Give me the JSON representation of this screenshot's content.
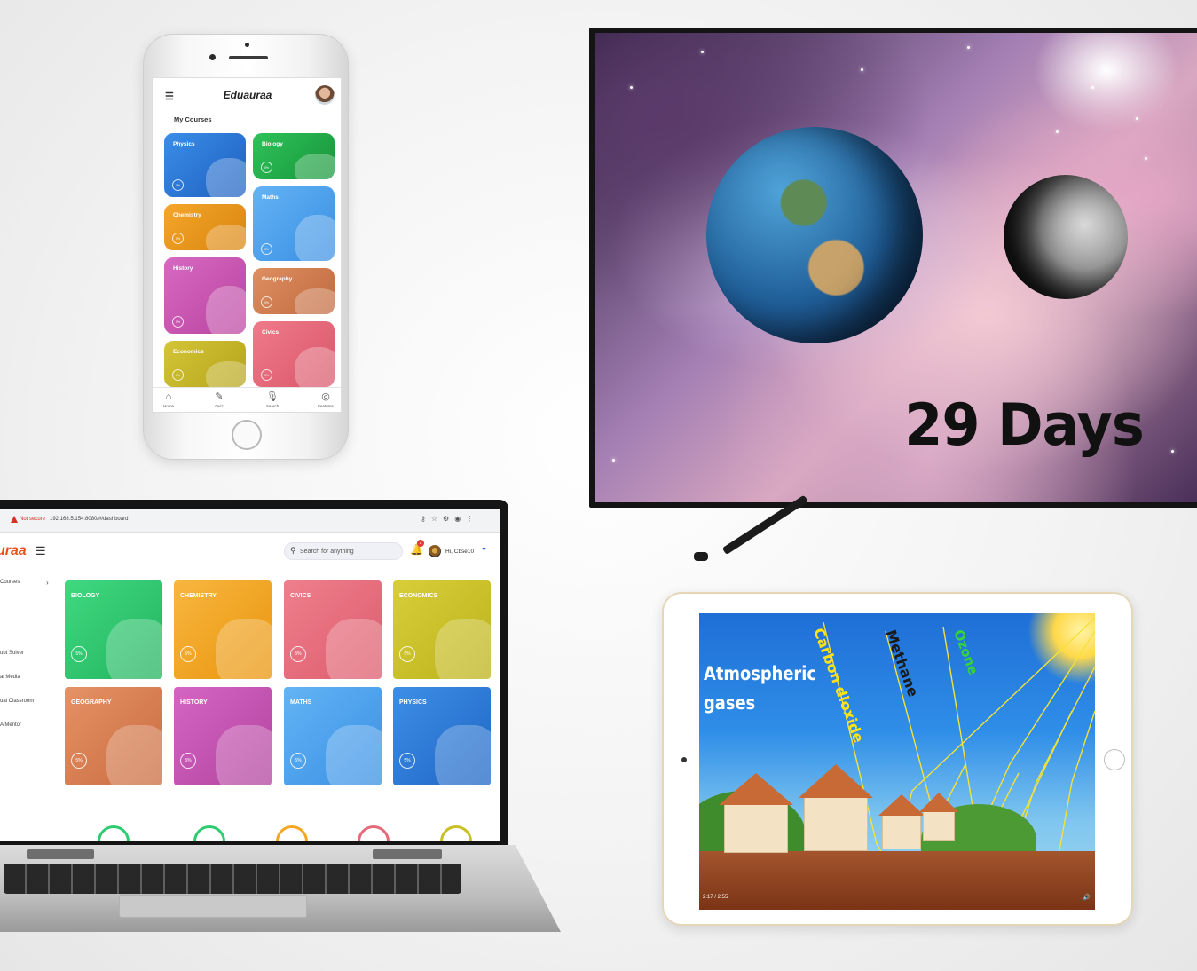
{
  "phone": {
    "app_name": "Eduauraa",
    "section_title": "My Courses",
    "courses": [
      {
        "label": "Physics",
        "color": "#2f79d9",
        "progress": "0%"
      },
      {
        "label": "Biology",
        "color": "#22b24c",
        "progress": "0%"
      },
      {
        "label": "Chemistry",
        "color": "#ee9a1d",
        "progress": "0%"
      },
      {
        "label": "Maths",
        "color": "#49a2ef",
        "progress": "0%"
      },
      {
        "label": "History",
        "color": "#cf5ab8",
        "progress": "0%"
      },
      {
        "label": "Geography",
        "color": "#d27d4f",
        "progress": "0%"
      },
      {
        "label": "Economics",
        "color": "#c8b72a",
        "progress": "0%"
      },
      {
        "label": "Civics",
        "color": "#e5697a",
        "progress": "0%"
      }
    ],
    "tabs": [
      {
        "label": "Home",
        "icon": "home-icon",
        "glyph": "⌂"
      },
      {
        "label": "Quiz",
        "icon": "quiz-icon",
        "glyph": "✎"
      },
      {
        "label": "Search",
        "icon": "microphone-icon",
        "glyph": "🎙"
      },
      {
        "label": "Features",
        "icon": "features-icon",
        "glyph": "◎"
      }
    ]
  },
  "tv": {
    "caption": "29 Days"
  },
  "laptop": {
    "browser": {
      "security_label": "Not secure",
      "url": "192.168.5.154:8080/#/dashboard"
    },
    "app_logo": "uraa",
    "search_placeholder": "Search for anything",
    "notification_count": "2",
    "greeting": "Hi, Cbse10",
    "sidebar": [
      {
        "label": "Courses"
      },
      {
        "label": "ubt Solver"
      },
      {
        "label": "al Media"
      },
      {
        "label": "ual Classroom"
      },
      {
        "label": "A Mentor"
      }
    ],
    "courses": [
      {
        "label": "BIOLOGY",
        "color": "#2ecc71",
        "progress": "5%"
      },
      {
        "label": "CHEMISTRY",
        "color": "#f5a623",
        "progress": "5%"
      },
      {
        "label": "CIVICS",
        "color": "#e56a7a",
        "progress": "5%"
      },
      {
        "label": "ECONOMICS",
        "color": "#c9bf26",
        "progress": "5%"
      },
      {
        "label": "GEOGRAPHY",
        "color": "#d97f55",
        "progress": "5%"
      },
      {
        "label": "HISTORY",
        "color": "#c951b5",
        "progress": "5%"
      },
      {
        "label": "MATHS",
        "color": "#4aa3ef",
        "progress": "5%"
      },
      {
        "label": "PHYSICS",
        "color": "#2f7fd9",
        "progress": "5%"
      }
    ],
    "ring_colors": [
      "#2ecc71",
      "#2ecc71",
      "#f5a623",
      "#e56a7a",
      "#c9bf26"
    ]
  },
  "tablet": {
    "title": "Atmospheric gases",
    "gases": [
      {
        "label": "Carbon dioxide",
        "color": "#ffe11a"
      },
      {
        "label": "Methane",
        "color": "#1a1a1a"
      },
      {
        "label": "Ozone",
        "color": "#35d43a"
      }
    ],
    "video_time": "2:17 / 2:55"
  }
}
